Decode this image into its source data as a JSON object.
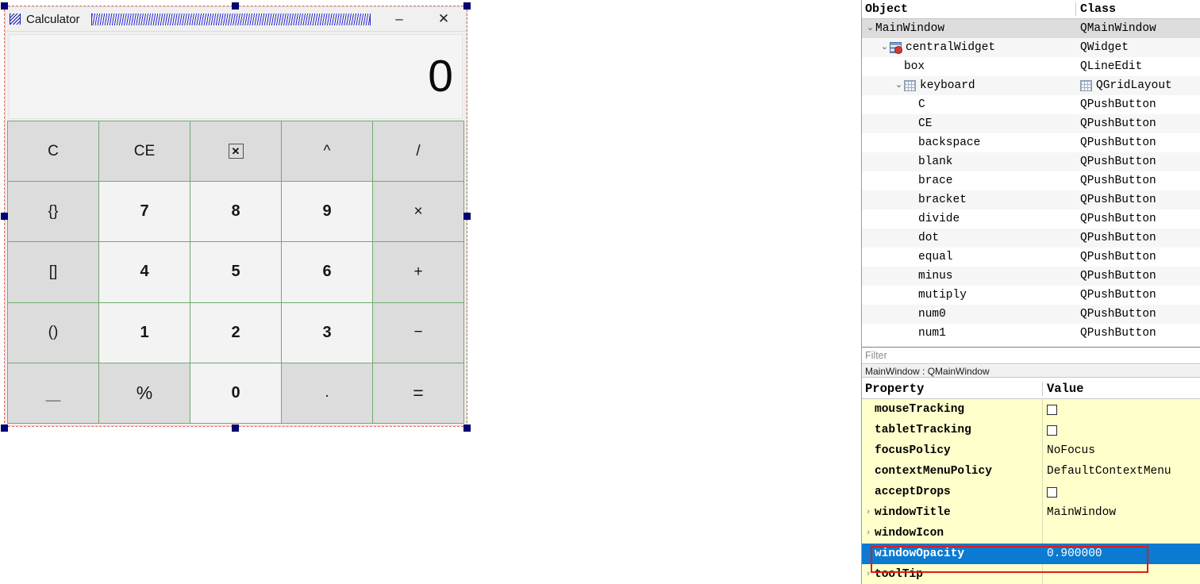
{
  "form": {
    "titlebar": {
      "icon": "window-grip-icon",
      "title": "Calculator",
      "minimize_label": "–",
      "close_label": "✕"
    },
    "display": {
      "value": "0"
    },
    "keys": [
      {
        "label": "C",
        "name": "key-clear",
        "kind": "op"
      },
      {
        "label": "CE",
        "name": "key-clear-entry",
        "kind": "op"
      },
      {
        "label": "☒",
        "name": "key-backspace",
        "kind": "backspace"
      },
      {
        "label": "^",
        "name": "key-power",
        "kind": "op"
      },
      {
        "label": "/",
        "name": "key-divide",
        "kind": "op"
      },
      {
        "label": "{}",
        "name": "key-brace",
        "kind": "op"
      },
      {
        "label": "7",
        "name": "key-num7",
        "kind": "num"
      },
      {
        "label": "8",
        "name": "key-num8",
        "kind": "num"
      },
      {
        "label": "9",
        "name": "key-num9",
        "kind": "num"
      },
      {
        "label": "×",
        "name": "key-multiply",
        "kind": "op"
      },
      {
        "label": "[]",
        "name": "key-bracket",
        "kind": "op"
      },
      {
        "label": "4",
        "name": "key-num4",
        "kind": "num"
      },
      {
        "label": "5",
        "name": "key-num5",
        "kind": "num"
      },
      {
        "label": "6",
        "name": "key-num6",
        "kind": "num"
      },
      {
        "label": "+",
        "name": "key-plus",
        "kind": "op"
      },
      {
        "label": "()",
        "name": "key-paren",
        "kind": "op"
      },
      {
        "label": "1",
        "name": "key-num1",
        "kind": "num"
      },
      {
        "label": "2",
        "name": "key-num2",
        "kind": "num"
      },
      {
        "label": "3",
        "name": "key-num3",
        "kind": "num"
      },
      {
        "label": "−",
        "name": "key-minus",
        "kind": "op"
      },
      {
        "label": "＿",
        "name": "key-blank",
        "kind": "op"
      },
      {
        "label": "%",
        "name": "key-percent",
        "kind": "op-lg"
      },
      {
        "label": "0",
        "name": "key-num0",
        "kind": "num"
      },
      {
        "label": ".",
        "name": "key-dot",
        "kind": "op"
      },
      {
        "label": "=",
        "name": "key-equal",
        "kind": "op-lg"
      }
    ]
  },
  "object_tree": {
    "headers": {
      "object": "Object",
      "class": "Class"
    },
    "rows": [
      {
        "object": "MainWindow",
        "class": "QMainWindow",
        "indent": 0,
        "twist": "v",
        "icon": "",
        "selected": true
      },
      {
        "object": "centralWidget",
        "class": "QWidget",
        "indent": 1,
        "twist": "v",
        "icon": "layout",
        "selected": false
      },
      {
        "object": "box",
        "class": "QLineEdit",
        "indent": 2,
        "twist": "",
        "icon": "",
        "selected": false
      },
      {
        "object": "keyboard",
        "class": "QGridLayout",
        "indent": 2,
        "twist": "v",
        "icon": "grid",
        "class_icon": "grid",
        "selected": false
      },
      {
        "object": "C",
        "class": "QPushButton",
        "indent": 3,
        "twist": "",
        "icon": "",
        "selected": false
      },
      {
        "object": "CE",
        "class": "QPushButton",
        "indent": 3,
        "twist": "",
        "icon": "",
        "selected": false
      },
      {
        "object": "backspace",
        "class": "QPushButton",
        "indent": 3,
        "twist": "",
        "icon": "",
        "selected": false
      },
      {
        "object": "blank",
        "class": "QPushButton",
        "indent": 3,
        "twist": "",
        "icon": "",
        "selected": false
      },
      {
        "object": "brace",
        "class": "QPushButton",
        "indent": 3,
        "twist": "",
        "icon": "",
        "selected": false
      },
      {
        "object": "bracket",
        "class": "QPushButton",
        "indent": 3,
        "twist": "",
        "icon": "",
        "selected": false
      },
      {
        "object": "divide",
        "class": "QPushButton",
        "indent": 3,
        "twist": "",
        "icon": "",
        "selected": false
      },
      {
        "object": "dot",
        "class": "QPushButton",
        "indent": 3,
        "twist": "",
        "icon": "",
        "selected": false
      },
      {
        "object": "equal",
        "class": "QPushButton",
        "indent": 3,
        "twist": "",
        "icon": "",
        "selected": false
      },
      {
        "object": "minus",
        "class": "QPushButton",
        "indent": 3,
        "twist": "",
        "icon": "",
        "selected": false
      },
      {
        "object": "mutiply",
        "class": "QPushButton",
        "indent": 3,
        "twist": "",
        "icon": "",
        "selected": false
      },
      {
        "object": "num0",
        "class": "QPushButton",
        "indent": 3,
        "twist": "",
        "icon": "",
        "selected": false
      },
      {
        "object": "num1",
        "class": "QPushButton",
        "indent": 3,
        "twist": "",
        "icon": "",
        "selected": false
      }
    ]
  },
  "filter": {
    "placeholder": "Filter",
    "value": ""
  },
  "selected_object_label": "MainWindow : QMainWindow",
  "property_editor": {
    "headers": {
      "property": "Property",
      "value": "Value"
    },
    "rows": [
      {
        "property": "mouseTracking",
        "value": "",
        "type": "checkbox",
        "expandable": false,
        "selected": false
      },
      {
        "property": "tabletTracking",
        "value": "",
        "type": "checkbox",
        "expandable": false,
        "selected": false
      },
      {
        "property": "focusPolicy",
        "value": "NoFocus",
        "type": "text",
        "expandable": false,
        "selected": false
      },
      {
        "property": "contextMenuPolicy",
        "value": "DefaultContextMenu",
        "type": "text",
        "expandable": false,
        "selected": false
      },
      {
        "property": "acceptDrops",
        "value": "",
        "type": "checkbox",
        "expandable": false,
        "selected": false
      },
      {
        "property": "windowTitle",
        "value": "MainWindow",
        "type": "text",
        "expandable": true,
        "selected": false
      },
      {
        "property": "windowIcon",
        "value": "",
        "type": "text",
        "expandable": true,
        "selected": false
      },
      {
        "property": "windowOpacity",
        "value": "0.900000",
        "type": "text",
        "expandable": false,
        "selected": true
      },
      {
        "property": "toolTip",
        "value": "",
        "type": "text",
        "expandable": true,
        "selected": false
      }
    ]
  }
}
